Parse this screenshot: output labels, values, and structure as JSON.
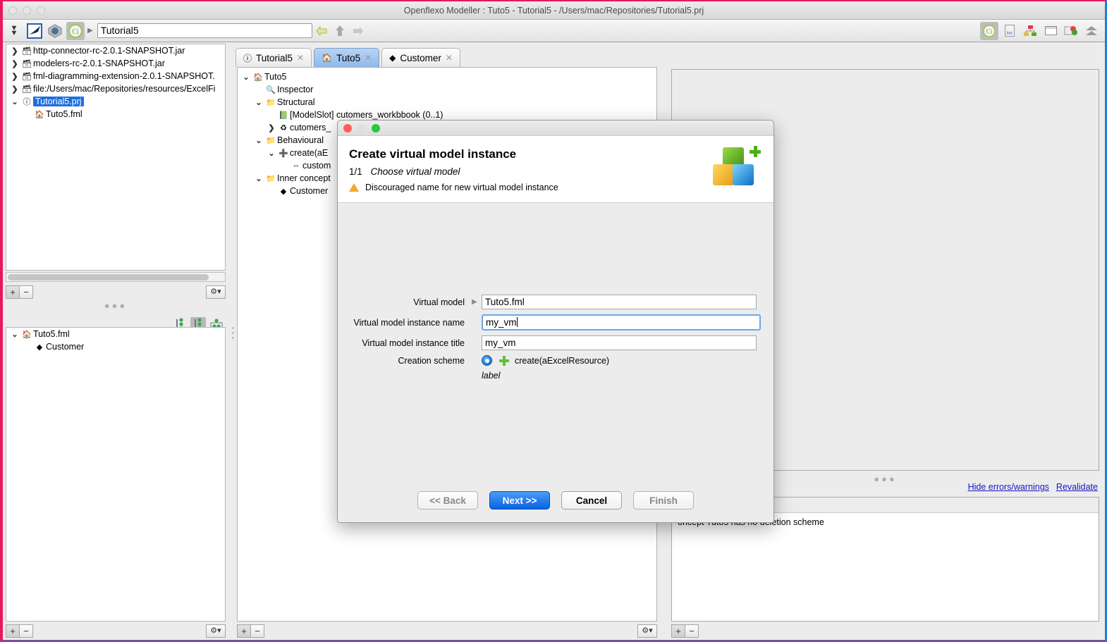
{
  "window": {
    "title": "Openflexo Modeller : Tuto5 - Tutorial5 - /Users/mac/Repositories/Tutorial5.prj"
  },
  "toolbar": {
    "path_value": "Tutorial5",
    "icons": [
      "chevrons-down-icon",
      "openflexo-logo-icon",
      "cube-perspective-icon",
      "ci-module-icon"
    ],
    "nav": [
      "back-arrow-icon",
      "up-arrow-icon",
      "forward-arrow-icon"
    ],
    "right_icons": [
      "ci-module-icon",
      "fml-file-icon",
      "diagram-icon",
      "window-icon",
      "validation-icon",
      "collapse-icon"
    ]
  },
  "left_panel": {
    "top_tree": [
      {
        "indent": 0,
        "twisty": "❯",
        "icon": "🗃",
        "label": "http-connector-rc-2.0.1-SNAPSHOT.jar",
        "selected": false
      },
      {
        "indent": 0,
        "twisty": "❯",
        "icon": "🗃",
        "label": "modelers-rc-2.0.1-SNAPSHOT.jar",
        "selected": false
      },
      {
        "indent": 0,
        "twisty": "❯",
        "icon": "🗃",
        "label": "fml-diagramming-extension-2.0.1-SNAPSHOT.",
        "selected": false
      },
      {
        "indent": 0,
        "twisty": "❯",
        "icon": "🗃",
        "label": "file:/Users/mac/Repositories/resources/ExcelFi",
        "selected": false
      },
      {
        "indent": 0,
        "twisty": "⌄",
        "icon": "ⓘ",
        "label": "Tutorial5.prj",
        "selected": true
      },
      {
        "indent": 1,
        "twisty": "",
        "icon": "🏠",
        "label": "Tuto5.fml",
        "selected": false
      }
    ],
    "bottom_tree": [
      {
        "indent": 0,
        "twisty": "⌄",
        "icon": "🏠",
        "label": "Tuto5.fml",
        "selected": false
      },
      {
        "indent": 1,
        "twisty": "",
        "icon": "◆",
        "label": "Customer",
        "selected": false
      }
    ],
    "add_label": "+",
    "remove_label": "−",
    "gear_label": "⚙▾"
  },
  "center_panel": {
    "tabs": [
      {
        "label": "Tutorial5",
        "icon": "ci-project-icon",
        "active": false,
        "close": "✕"
      },
      {
        "label": "Tuto5",
        "icon": "virtual-model-icon",
        "active": true,
        "close": "✕"
      },
      {
        "label": "Customer",
        "icon": "flexo-concept-icon",
        "active": false,
        "close": "✕"
      }
    ],
    "tree": [
      {
        "indent": 0,
        "twisty": "⌄",
        "icon": "🏠",
        "label": "Tuto5"
      },
      {
        "indent": 1,
        "twisty": "",
        "icon": "🔍",
        "label": "Inspector"
      },
      {
        "indent": 1,
        "twisty": "⌄",
        "icon": "📁",
        "label": "Structural"
      },
      {
        "indent": 2,
        "twisty": "",
        "icon": "📗",
        "label": "[ModelSlot] cutomers_workbbook (0..1)"
      },
      {
        "indent": 2,
        "twisty": "❯",
        "icon": "♻",
        "label": "cutomers_"
      },
      {
        "indent": 1,
        "twisty": "⌄",
        "icon": "📁",
        "label": "Behavioural"
      },
      {
        "indent": 2,
        "twisty": "⌄",
        "icon": "➕",
        "label": "create(aE"
      },
      {
        "indent": 3,
        "twisty": "",
        "icon": "⇔",
        "label": "custom"
      },
      {
        "indent": 1,
        "twisty": "⌄",
        "icon": "📁",
        "label": "Inner concept"
      },
      {
        "indent": 2,
        "twisty": "",
        "icon": "◆",
        "label": "Customer"
      }
    ],
    "add_label": "+",
    "remove_label": "−",
    "gear_label": "⚙▾"
  },
  "right_panel": {
    "hide_errors_link": "Hide errors/warnings",
    "revalidate_link": "Revalidate",
    "error_message": "oncept Tuto5 has no deletion scheme",
    "add_label": "+",
    "remove_label": "−"
  },
  "dialog": {
    "title": "Create virtual model instance",
    "step_number": "1/1",
    "step_label": "Choose virtual model",
    "warning": "Discouraged name for new virtual model instance",
    "fields": [
      {
        "label": "Virtual model",
        "value": "Tuto5.fml",
        "has_tri": true,
        "focused": false
      },
      {
        "label": "Virtual model instance name",
        "value": "my_vm",
        "has_tri": false,
        "focused": true
      },
      {
        "label": "Virtual model instance title",
        "value": "my_vm",
        "has_tri": false,
        "focused": false
      }
    ],
    "scheme_label": "Creation scheme",
    "scheme_value": "create(aExcelResource)",
    "scheme_sublabel": "label",
    "buttons": {
      "back": "<< Back",
      "next": "Next >>",
      "cancel": "Cancel",
      "finish": "Finish"
    }
  },
  "colors": {
    "selection_blue": "#1c6fe0",
    "primary_button": "#0a63e0",
    "link_blue": "#1616c8",
    "warning_orange": "#f0a830"
  }
}
